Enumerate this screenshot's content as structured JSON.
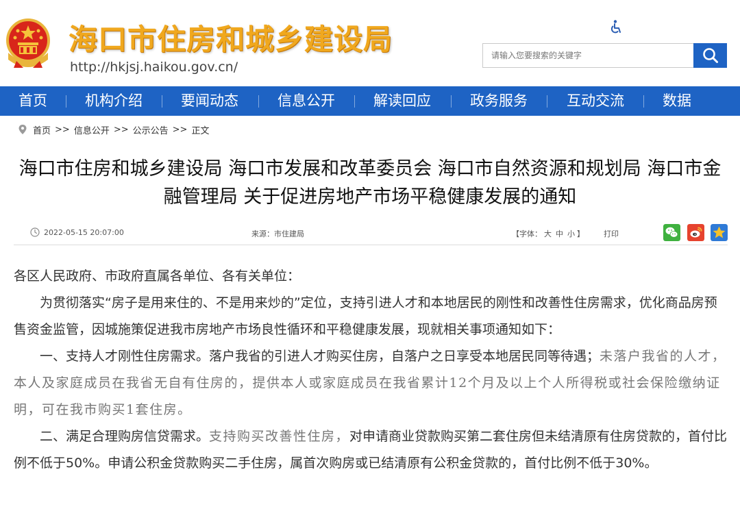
{
  "header": {
    "site_title": "海口市住房和城乡建设局",
    "site_url": "http://hkjsj.haikou.gov.cn/",
    "search_placeholder": "请输入您要搜索的关键字",
    "colors": {
      "title": "#f0a81e",
      "nav": "#1e63c4"
    }
  },
  "nav": {
    "items": [
      "首页",
      "机构介绍",
      "要闻动态",
      "信息公开",
      "解读回应",
      "政务服务",
      "互动交流",
      "数据"
    ]
  },
  "breadcrumb": {
    "items": [
      "首页",
      "信息公开",
      "公示公告",
      "正文"
    ],
    "separator": ">>"
  },
  "article": {
    "title": "海口市住房和城乡建设局 海口市发展和改革委员会 海口市自然资源和规划局 海口市金融管理局 关于促进房地产市场平稳健康发展的通知",
    "meta": {
      "date": "2022-05-15 20:07:00",
      "source_label": "来源：",
      "source_value": "市住建局",
      "font_label": "【字体：",
      "font_large": "大",
      "font_medium": "中",
      "font_small": "小",
      "font_close": "】",
      "print": "打印"
    },
    "share_icons": [
      "wechat-icon",
      "weibo-icon",
      "qzone-icon"
    ],
    "body": {
      "salutation": "各区人民政府、市政府直属各单位、各有关单位：",
      "intro": "为贯彻落实“房子是用来住的、不是用来炒的”定位，支持引进人才和本地居民的刚性和改善性住房需求，优化商品房预售资金监管，因城施策促进我市房地产市场良性循环和平稳健康发展，现就相关事项通知如下：",
      "item1_a": "一、支持人才刚性住房需求。落户我省的引进人才购买住房，自落户之日享受本地居民同等待遇；",
      "item1_b": "未落户我省的人才，本人及家庭成员在我省无自有住房的，提供本人或家庭成员在我省累计12个月及以上个人所得税或社会保险缴纳证明，可在我市购买1套住房。",
      "item2_a": "二、满足合理购房信贷需求。",
      "item2_b": "支持购买改善性住房，",
      "item2_c": "对申请商业贷款购买第二套住房但未结清原有住房贷款的，首付比例不低于50%。申请公积金贷款购买二手住房，属首次购房或已结清原有公积金贷款的，首付比例不低于30%。"
    }
  }
}
